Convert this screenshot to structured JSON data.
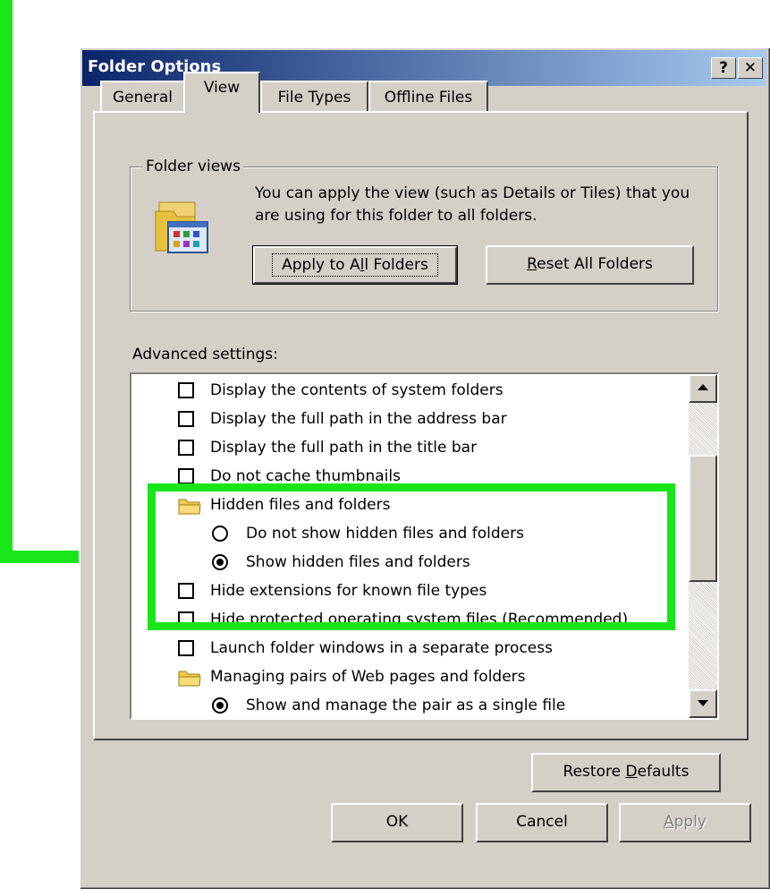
{
  "window": {
    "title": "Folder Options",
    "help_glyph": "?",
    "close_glyph": "✕"
  },
  "tabs": [
    {
      "label": "General",
      "active": false
    },
    {
      "label": "View",
      "active": true
    },
    {
      "label": "File Types",
      "active": false
    },
    {
      "label": "Offline Files",
      "active": false
    }
  ],
  "folder_views": {
    "legend": "Folder views",
    "description": "You can apply the view (such as Details or Tiles) that you are using for this folder to all folders.",
    "apply_all_pre": "Apply to A",
    "apply_all_key": "l",
    "apply_all_post": "l Folders",
    "reset_all_pre": "",
    "reset_all_key": "R",
    "reset_all_post": "eset All Folders"
  },
  "advanced": {
    "label": "Advanced settings:",
    "items": [
      {
        "kind": "checkbox",
        "checked": false,
        "indent": 1,
        "text": "Display the contents of system folders"
      },
      {
        "kind": "checkbox",
        "checked": false,
        "indent": 1,
        "text": "Display the full path in the address bar"
      },
      {
        "kind": "checkbox",
        "checked": false,
        "indent": 1,
        "text": "Display the full path in the title bar"
      },
      {
        "kind": "checkbox",
        "checked": false,
        "indent": 1,
        "text": "Do not cache thumbnails"
      },
      {
        "kind": "folder",
        "indent": 1,
        "text": "Hidden files and folders"
      },
      {
        "kind": "radio",
        "checked": false,
        "indent": 2,
        "text": "Do not show hidden files and folders"
      },
      {
        "kind": "radio",
        "checked": true,
        "indent": 2,
        "text": "Show hidden files and folders"
      },
      {
        "kind": "checkbox",
        "checked": false,
        "indent": 1,
        "text": "Hide extensions for known file types"
      },
      {
        "kind": "checkbox",
        "checked": false,
        "indent": 1,
        "text": "Hide protected operating system files (Recommended)"
      },
      {
        "kind": "checkbox",
        "checked": false,
        "indent": 1,
        "text": "Launch folder windows in a separate process"
      },
      {
        "kind": "folder",
        "indent": 1,
        "text": "Managing pairs of Web pages and folders"
      },
      {
        "kind": "radio",
        "checked": true,
        "indent": 2,
        "text": "Show and manage the pair as a single file"
      }
    ]
  },
  "buttons": {
    "restore_pre": "Restore ",
    "restore_key": "D",
    "restore_post": "efaults",
    "ok": "OK",
    "cancel": "Cancel",
    "apply_key": "A",
    "apply_post": "pply"
  },
  "colors": {
    "annotation": "#19e619",
    "titlebar_start": "#0a246a",
    "titlebar_end": "#a6caf0",
    "face": "#d4d0c8"
  }
}
